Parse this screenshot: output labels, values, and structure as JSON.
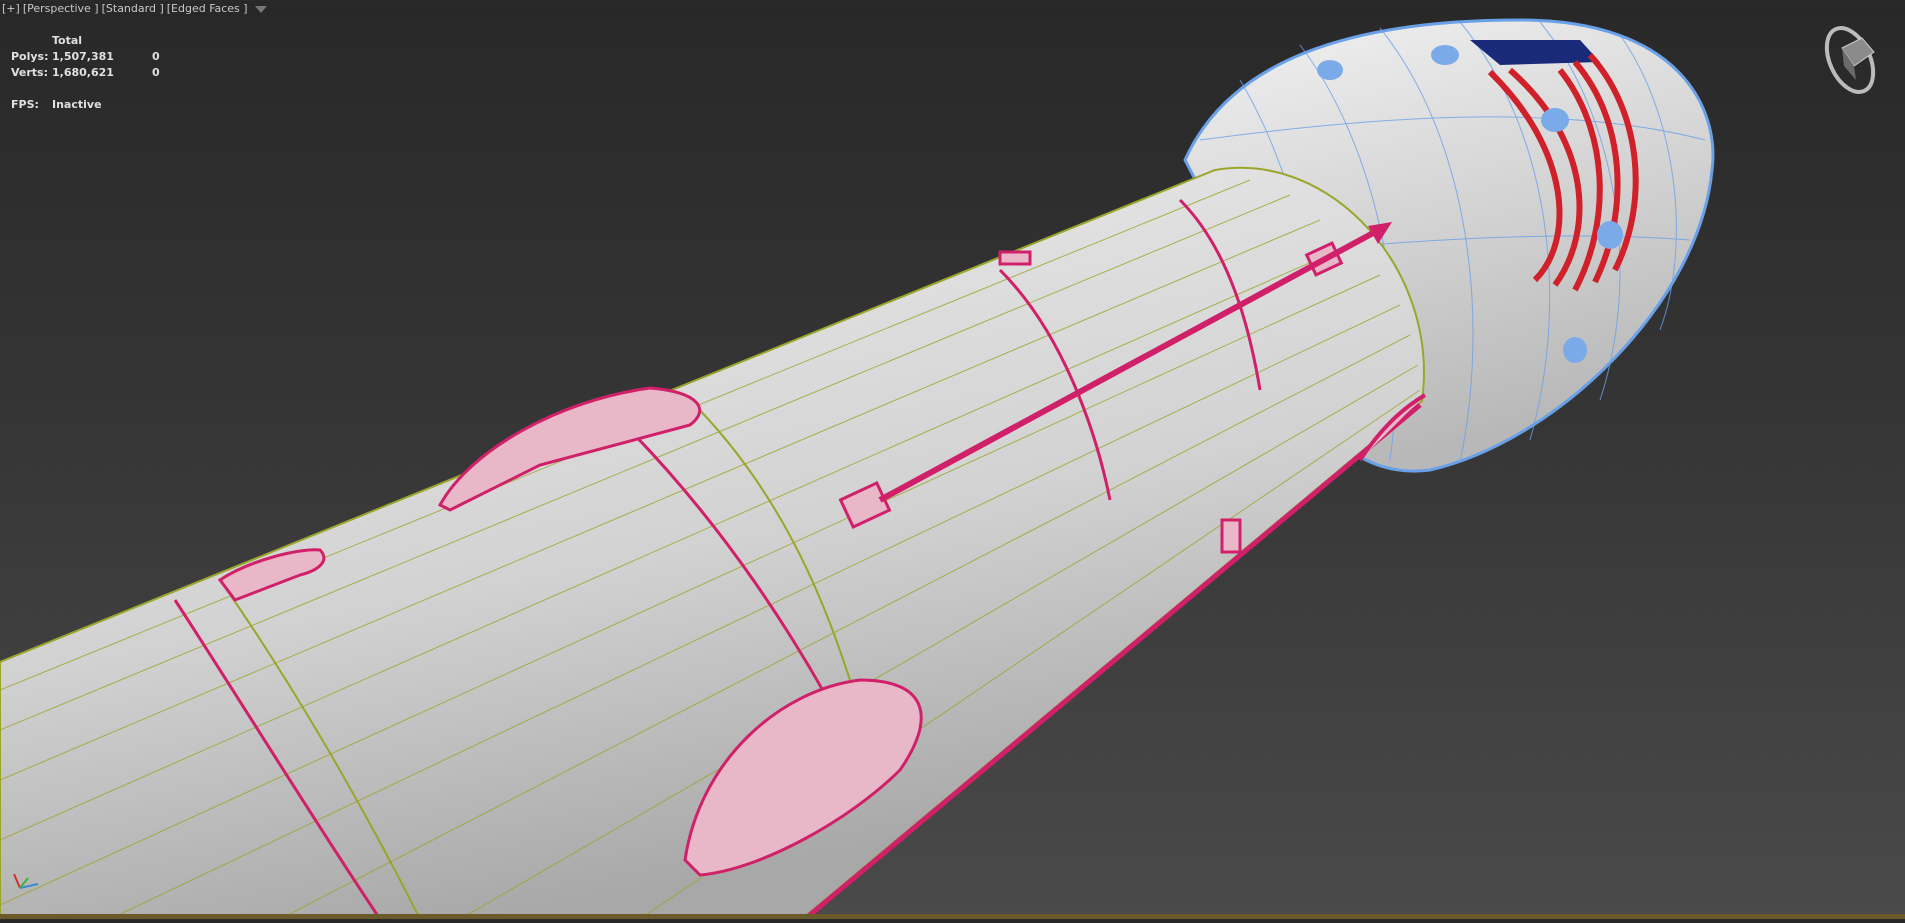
{
  "viewport": {
    "labels": [
      "[+]",
      "[Perspective ]",
      "[Standard ]",
      "[Edged Faces ]"
    ],
    "filter_icon": "filter-icon"
  },
  "stats": {
    "header": "Total",
    "polys_label": "Polys:",
    "polys_total": "1,507,381",
    "polys_selected": "0",
    "verts_label": "Verts:",
    "verts_total": "1,680,621",
    "verts_selected": "0",
    "fps_label": "FPS:",
    "fps_value": "Inactive"
  },
  "colors": {
    "wire_body": "#9aa52a",
    "wire_selected": "#d0206a",
    "wire_capsule": "#6aa0e8"
  }
}
